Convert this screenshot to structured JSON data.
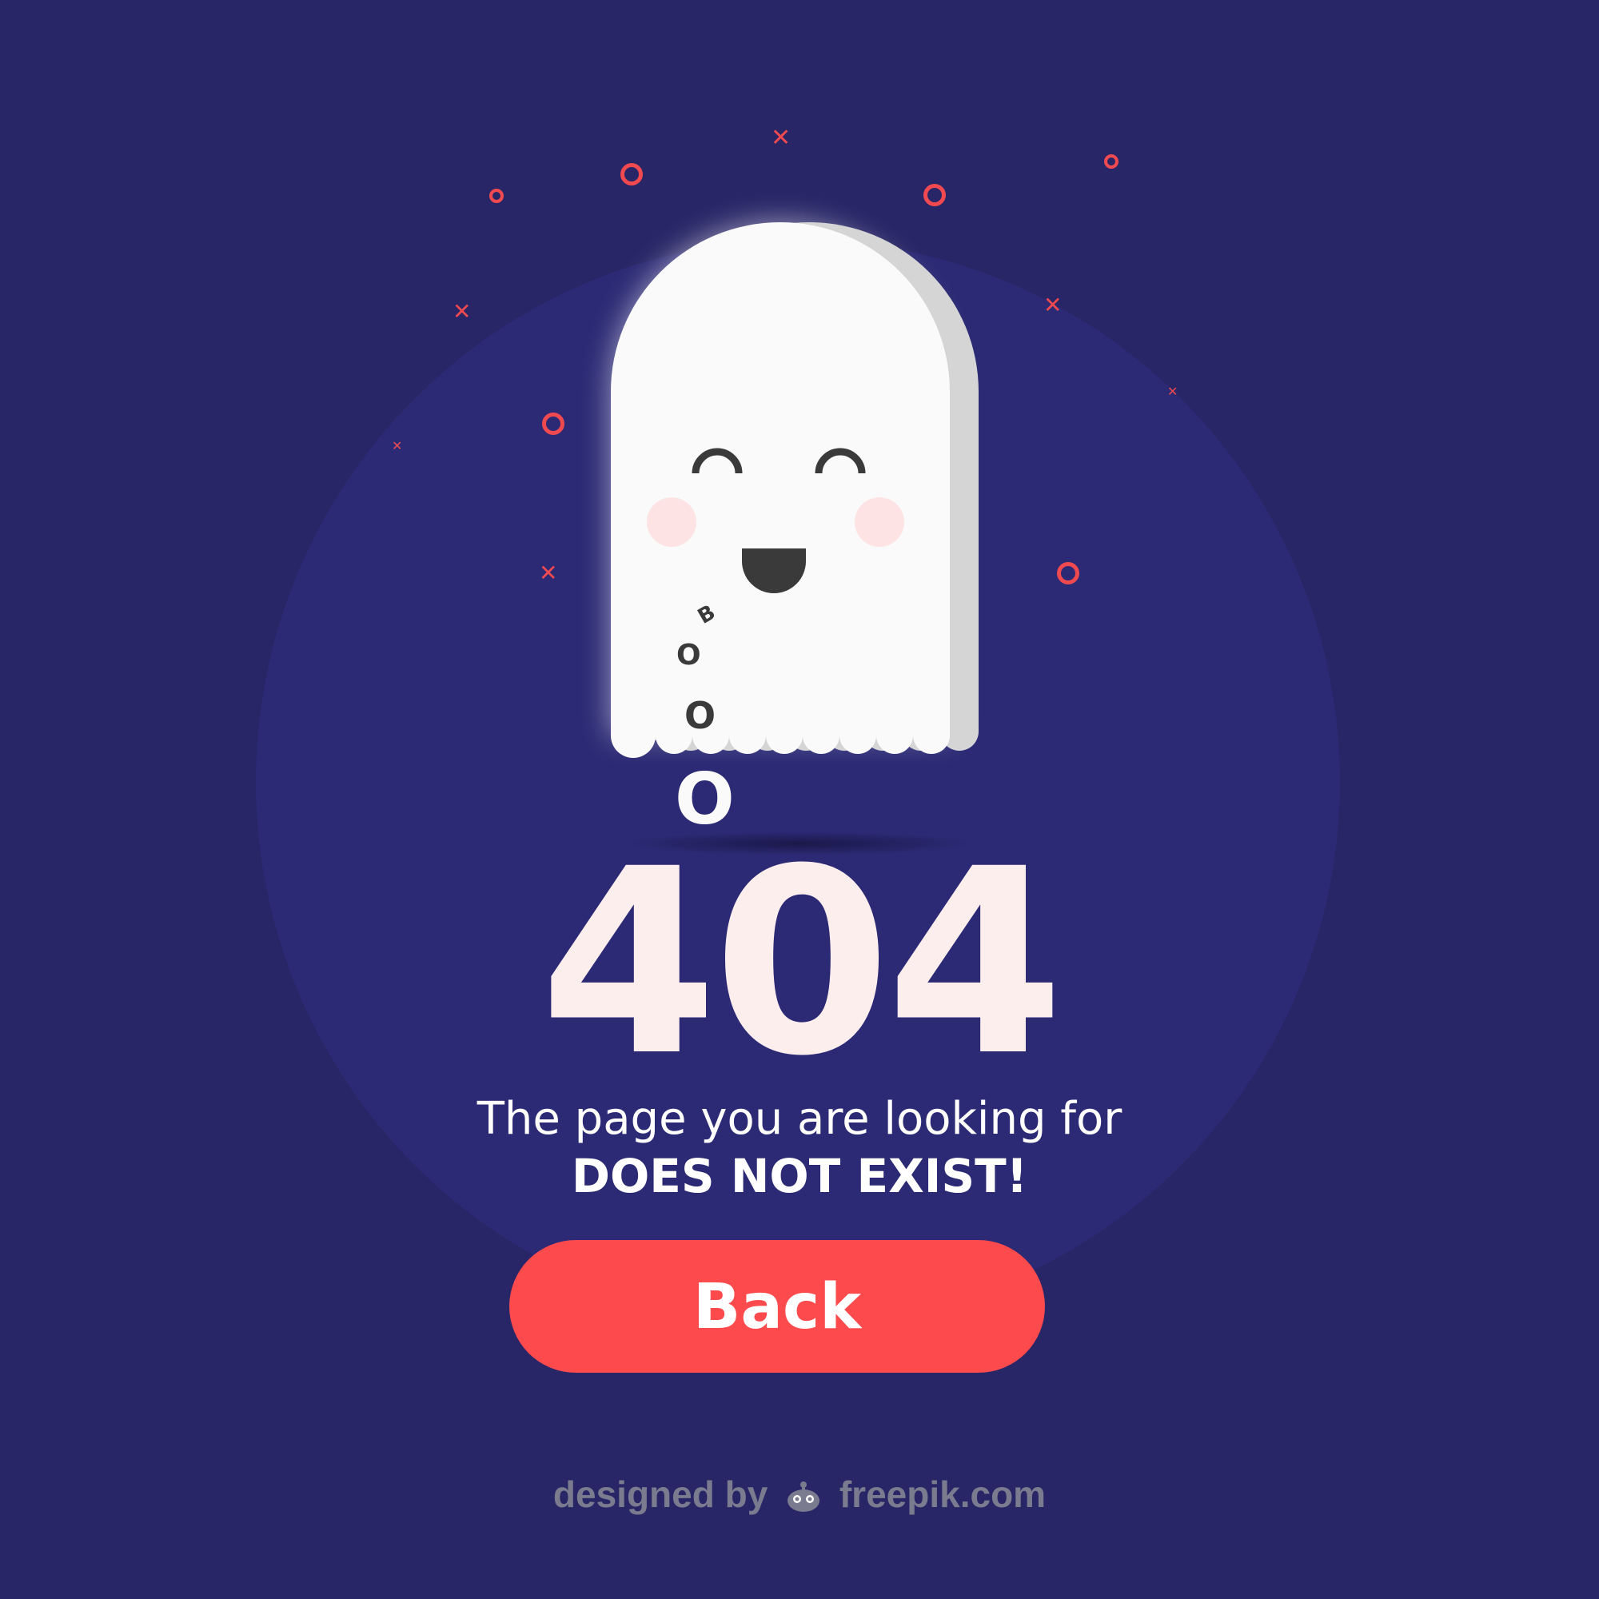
{
  "error": {
    "code": "404",
    "message_line1": "The page you are looking for",
    "message_line2": "DOES NOT EXIST!"
  },
  "actions": {
    "back_label": "Back"
  },
  "ghost": {
    "boo_letters": [
      "B",
      "O",
      "O",
      "O"
    ]
  },
  "footer": {
    "credit_prefix": "designed by",
    "credit_site": "freepik.com",
    "logo_icon": "freepik-logo-icon"
  },
  "colors": {
    "background": "#282666",
    "circle": "#2c2a74",
    "accent": "#fd4a4c",
    "sparkle": "#f04a50",
    "ghost_body": "#fafafa",
    "ghost_side": "#d5d5d5",
    "number": "#fdeeee"
  }
}
